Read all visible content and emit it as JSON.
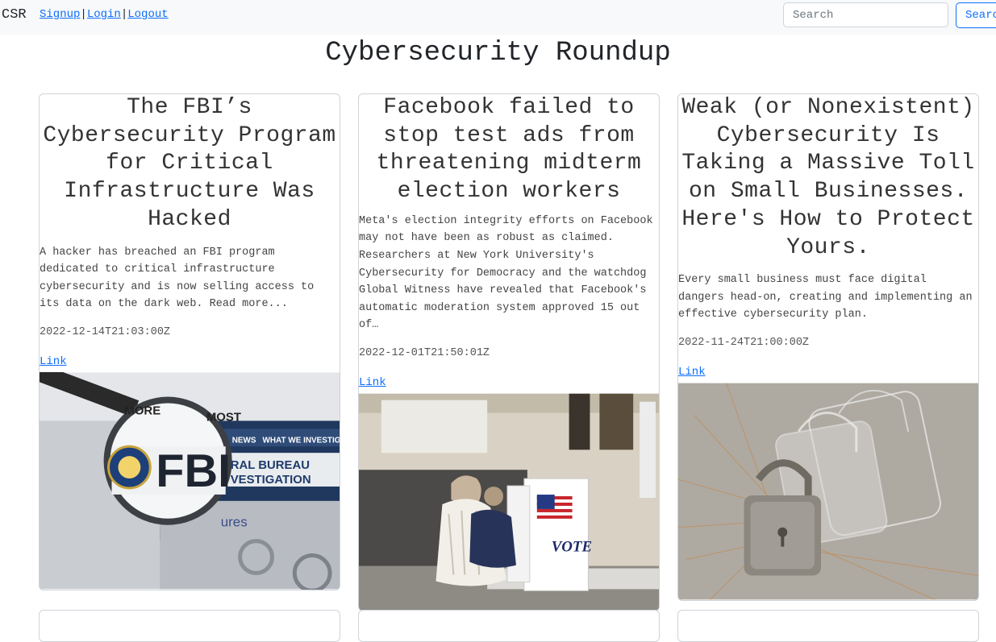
{
  "nav": {
    "brand": "CSR",
    "links": [
      "Signup",
      "Login",
      "Logout"
    ],
    "separator": "|",
    "search_placeholder": "Search",
    "search_button": "Search"
  },
  "page_title": "Cybersecurity Roundup",
  "articles": [
    {
      "title": "The FBI’s Cybersecurity Program for Critical Infrastructure Was Hacked",
      "description": "A hacker has breached an FBI program dedicated to critical infrastructure cybersecurity and is now selling access to its data on the dark web. Read more...",
      "date": "2022-12-14T21:03:00Z",
      "link_label": "Link",
      "image_text": [
        "MORE",
        "MOST",
        "FBI",
        "NEWS",
        "WHAT WE INVESTIGATE",
        "RAL BUREAU",
        "VESTIGATION",
        "ures"
      ]
    },
    {
      "title": "Facebook failed to stop test ads from threatening midterm election workers",
      "description": "Meta's election integrity efforts on Facebook may not have been as robust as claimed. Researchers at New York University's Cybersecurity for Democracy and the watchdog Global Witness have revealed that Facebook's automatic moderation system approved 15 out of…",
      "date": "2022-12-01T21:50:01Z",
      "link_label": "Link",
      "image_text": [
        "VOTE"
      ]
    },
    {
      "title": "Weak (or Nonexistent) Cybersecurity Is Taking a Massive Toll on Small Businesses. Here's How to Protect Yours.",
      "description": "Every small business must face digital dangers head-on, creating and implementing an effective cybersecurity plan.",
      "date": "2022-11-24T21:00:00Z",
      "link_label": "Link",
      "image_text": []
    }
  ]
}
